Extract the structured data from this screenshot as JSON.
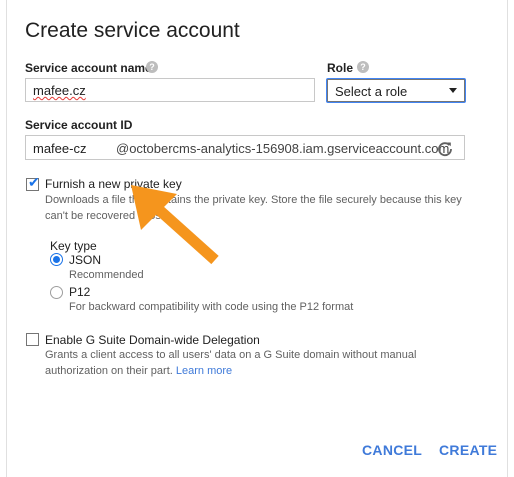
{
  "dialog": {
    "title": "Create service account",
    "service_account_name": {
      "label": "Service account name",
      "value": "mafee.cz"
    },
    "role": {
      "label": "Role",
      "selected": "Select a role"
    },
    "service_account_id": {
      "label": "Service account ID",
      "value": "mafee-cz",
      "suffix": "@octobercms-analytics-156908.iam.gserviceaccount.com"
    },
    "private_key": {
      "label": "Furnish a new private key",
      "checked": true,
      "description_line1": "Downloads a file that contains the private key. Store the file securely because this key",
      "description_line2": "can't be recovered if lost."
    },
    "key_type": {
      "label": "Key type",
      "options": [
        {
          "label": "JSON",
          "note": "Recommended",
          "selected": true
        },
        {
          "label": "P12",
          "note": "For backward compatibility with code using the P12 format",
          "selected": false
        }
      ]
    },
    "delegation": {
      "label": "Enable G Suite Domain-wide Delegation",
      "checked": false,
      "description_line1": "Grants a client access to all users' data on a G Suite domain without manual",
      "description_line2": "authorization on their part.",
      "learn_more": "Learn more"
    },
    "cancel_label": "CANCEL",
    "create_label": "CREATE"
  },
  "colors": {
    "accent": "#1a73e8",
    "button_text": "#3f7ad9",
    "annotation_arrow": "#f5951d"
  },
  "help_glyph": "?"
}
